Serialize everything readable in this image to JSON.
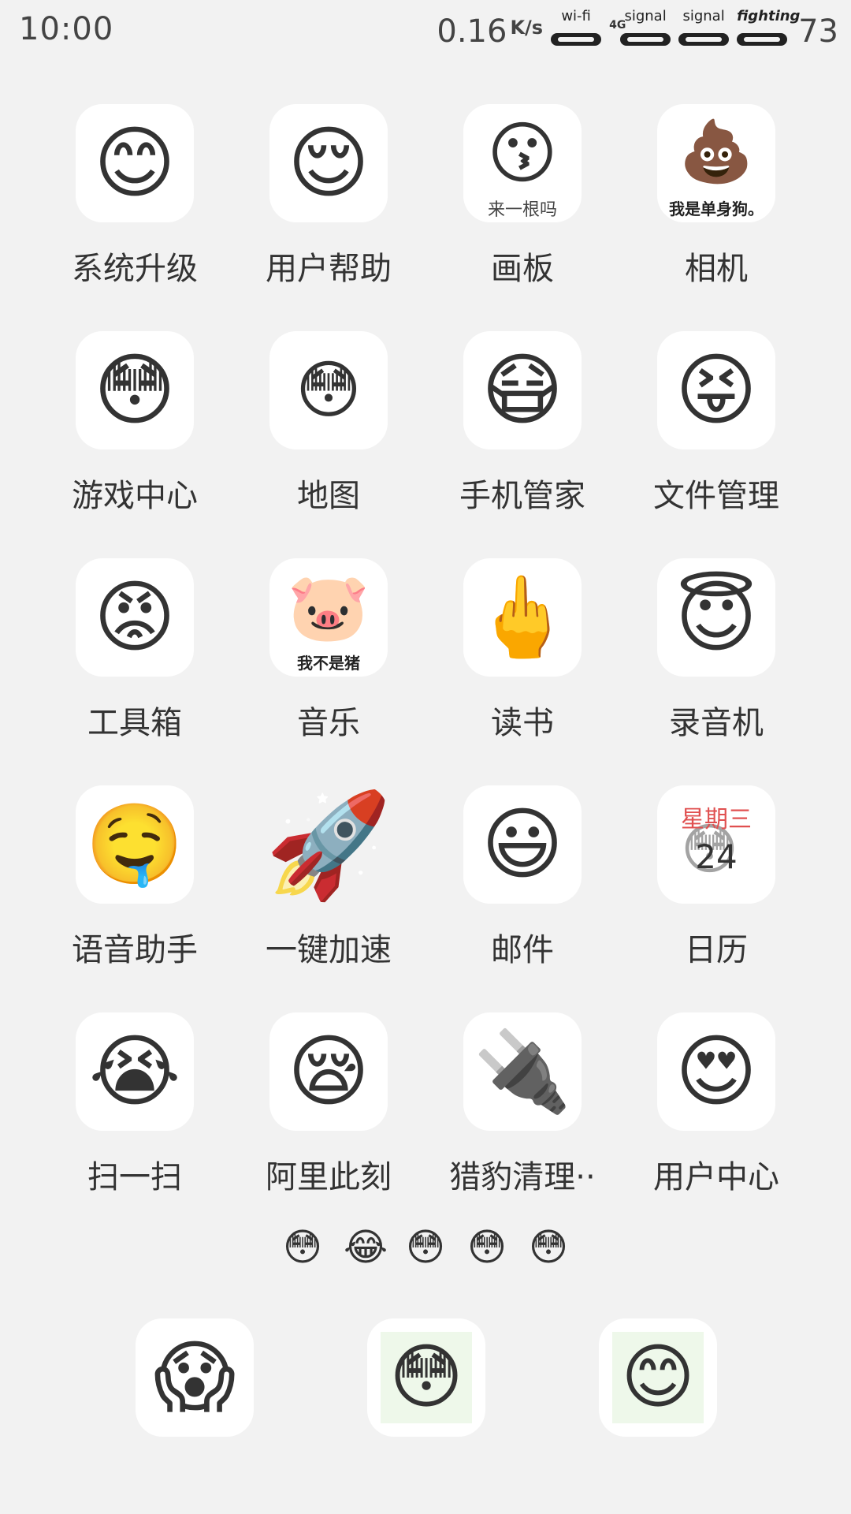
{
  "status_bar": {
    "time": "10:00",
    "speed_value": "0.16",
    "speed_unit": "K/s",
    "indicators": [
      {
        "label": "wi-fi",
        "prefix": ""
      },
      {
        "label": "signal",
        "prefix": "4G"
      },
      {
        "label": "signal",
        "prefix": ""
      },
      {
        "label": "fighting",
        "prefix": ""
      }
    ],
    "battery": "73"
  },
  "apps": [
    {
      "label": "系统升级",
      "emoji": "😊",
      "caption": ""
    },
    {
      "label": "用户帮助",
      "emoji": "😌",
      "caption": ""
    },
    {
      "label": "画板",
      "emoji": "😗",
      "caption": "来一根吗"
    },
    {
      "label": "相机",
      "emoji": "💩",
      "caption": "我是单身狗。"
    },
    {
      "label": "游戏中心",
      "emoji": "😳",
      "caption": ""
    },
    {
      "label": "地图",
      "emoji": "😳",
      "caption": ""
    },
    {
      "label": "手机管家",
      "emoji": "😷",
      "caption": ""
    },
    {
      "label": "文件管理",
      "emoji": "😝",
      "caption": ""
    },
    {
      "label": "工具箱",
      "emoji": "😡",
      "caption": ""
    },
    {
      "label": "音乐",
      "emoji": "🐷",
      "caption": "我不是猪"
    },
    {
      "label": "读书",
      "emoji": "🖕",
      "caption": ""
    },
    {
      "label": "录音机",
      "emoji": "😇",
      "caption": ""
    },
    {
      "label": "语音助手",
      "emoji": "🤤",
      "caption": ""
    },
    {
      "label": "一键加速",
      "emoji": "🚀",
      "caption": ""
    },
    {
      "label": "邮件",
      "emoji": "😃",
      "caption": ""
    },
    {
      "label": "日历",
      "emoji": "😳",
      "caption": ""
    },
    {
      "label": "扫一扫",
      "emoji": "😭",
      "caption": ""
    },
    {
      "label": "阿里此刻",
      "emoji": "😪",
      "caption": ""
    },
    {
      "label": "猎豹清理··",
      "emoji": "🔌",
      "caption": ""
    },
    {
      "label": "用户中心",
      "emoji": "😍",
      "caption": ""
    }
  ],
  "calendar": {
    "weekday": "星期三",
    "day": "24"
  },
  "page_indicator": {
    "dots": [
      "😳",
      "😂",
      "😳",
      "😳",
      "😳"
    ],
    "current_page": 2
  },
  "dock": [
    {
      "emoji": "😱",
      "name": "dock-app-1"
    },
    {
      "emoji": "😳",
      "name": "dock-app-2"
    },
    {
      "emoji": "😊",
      "name": "dock-app-3"
    }
  ]
}
